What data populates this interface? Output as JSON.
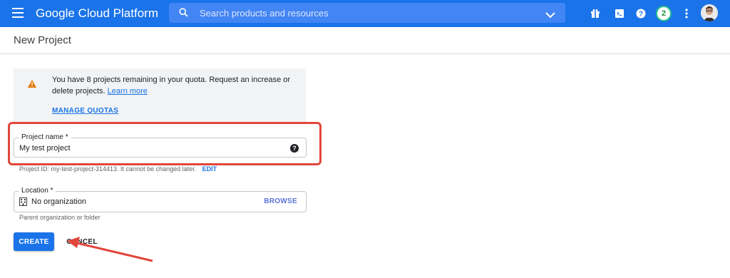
{
  "header": {
    "brand": "Google Cloud Platform",
    "search_placeholder": "Search products and resources",
    "notification_count": "2"
  },
  "page": {
    "title": "New Project"
  },
  "notice": {
    "text": "You have 8 projects remaining in your quota. Request an increase or delete projects.",
    "link_label": "Learn more",
    "manage_label": "MANAGE QUOTAS"
  },
  "project_name": {
    "label": "Project name *",
    "value": "My test project",
    "id_text": "Project ID: my-test-project-314413. It cannot be changed later.",
    "edit_label": "EDIT"
  },
  "location": {
    "label": "Location *",
    "value": "No organization",
    "browse_label": "BROWSE",
    "hint": "Parent organization or folder"
  },
  "actions": {
    "create_label": "CREATE",
    "cancel_label": "CANCEL"
  },
  "colors": {
    "brand_blue": "#1a73e8",
    "annotation_red": "#e2463b",
    "warning_orange": "#e37400"
  },
  "icons": {
    "menu": "hamburger-icon",
    "search": "search-icon",
    "gift": "gift-icon",
    "terminal": "cloud-shell-icon",
    "help": "help-icon",
    "more": "more-vert-icon",
    "warning": "warning-icon",
    "building": "building-icon"
  }
}
